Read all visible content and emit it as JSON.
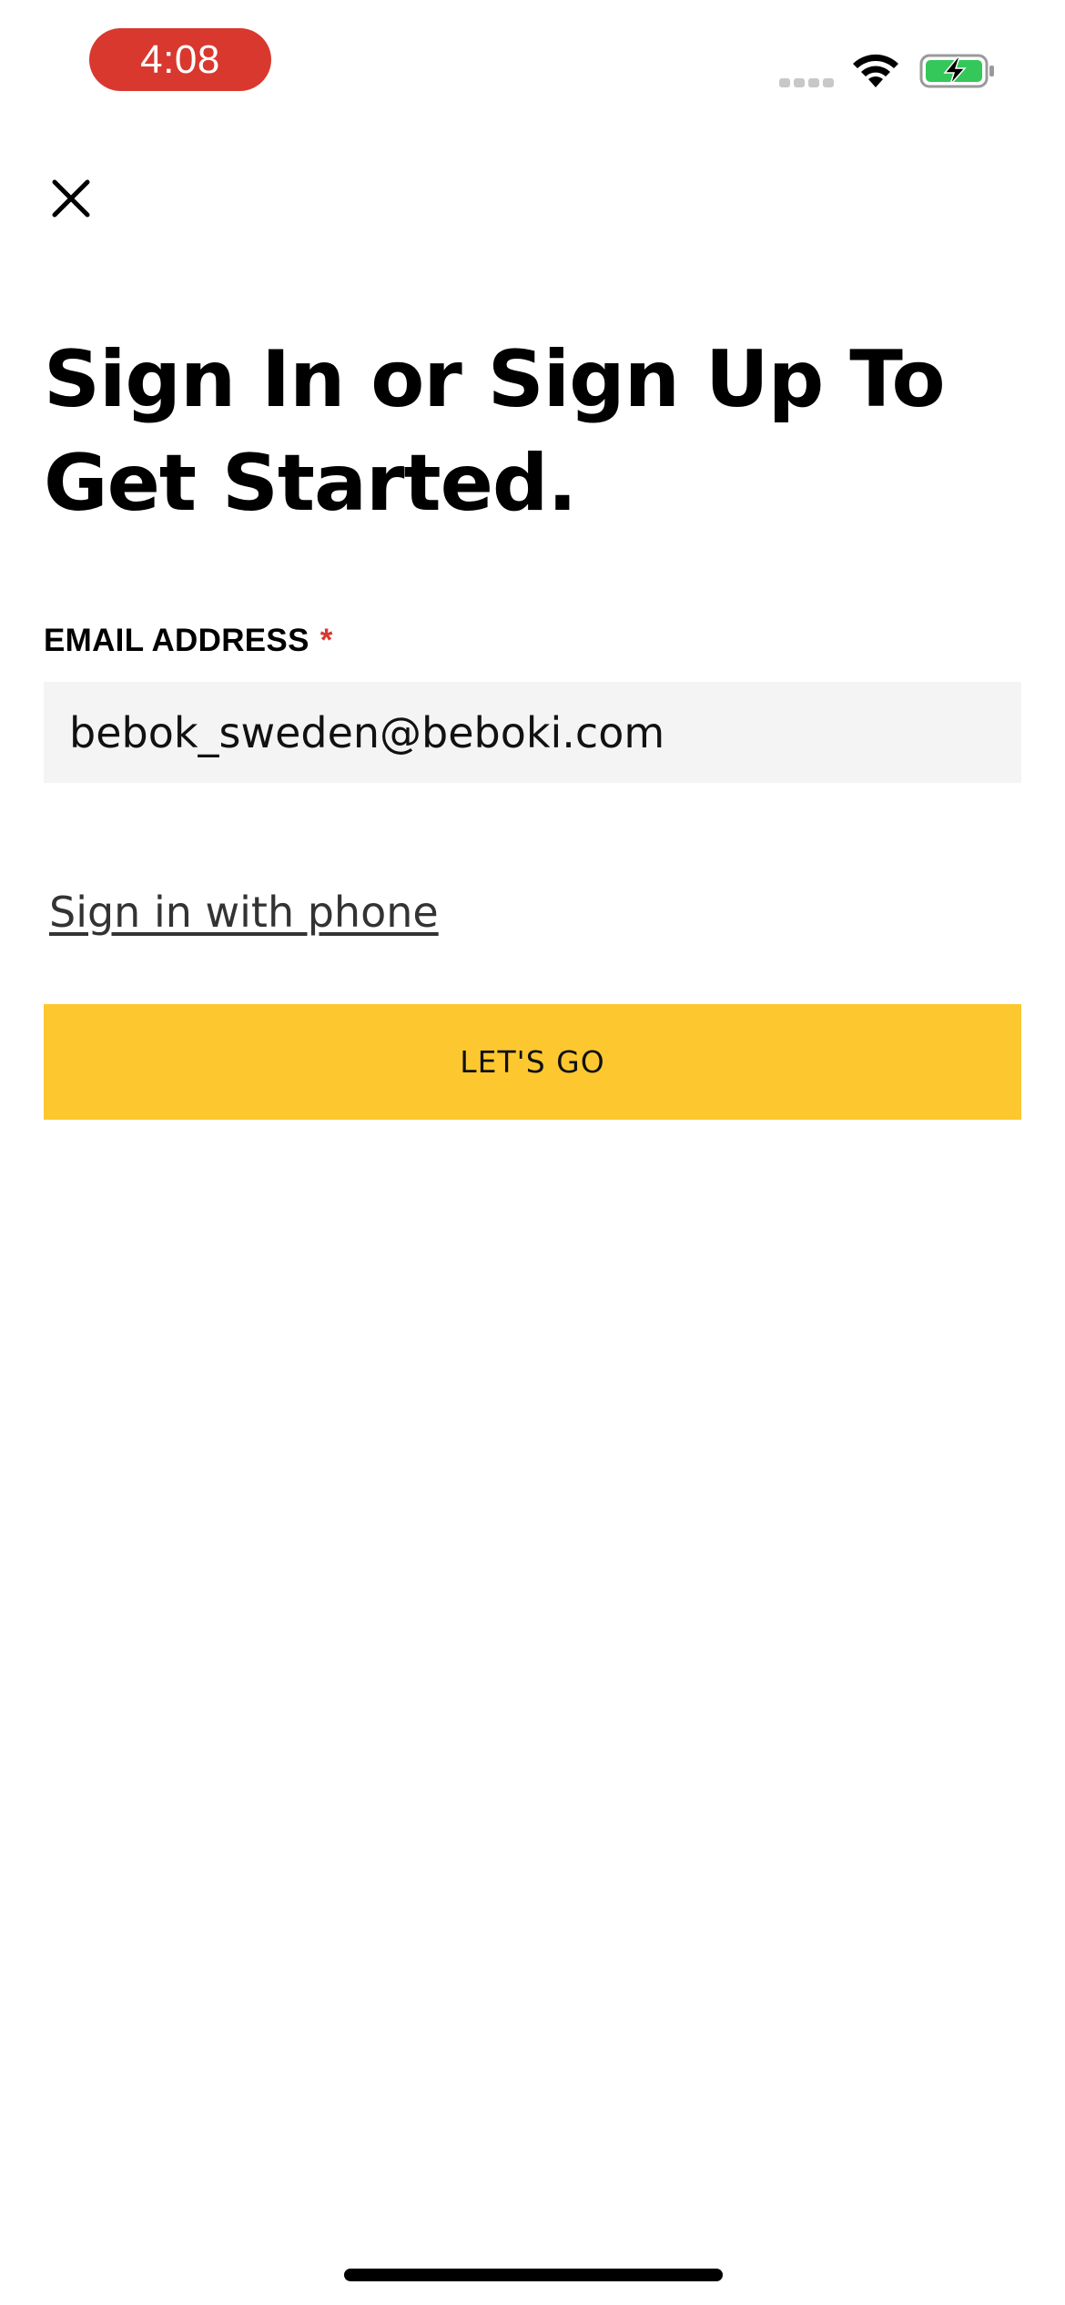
{
  "status_bar": {
    "time": "4:08",
    "time_pill_color": "#d9382f",
    "icons": [
      "signal-icon",
      "wifi-icon",
      "battery-charging-icon"
    ]
  },
  "header": {
    "close_icon": "close-icon"
  },
  "main": {
    "headline": "Sign In or Sign Up To Get Started.",
    "email_label": "EMAIL ADDRESS",
    "required_marker": "*",
    "email_value": "bebok_sweden@beboki.com",
    "phone_link": "Sign in with phone",
    "submit_label": "LET'S GO"
  },
  "colors": {
    "accent": "#fdc82f",
    "required": "#d9382f",
    "input_background": "#f4f4f4"
  }
}
